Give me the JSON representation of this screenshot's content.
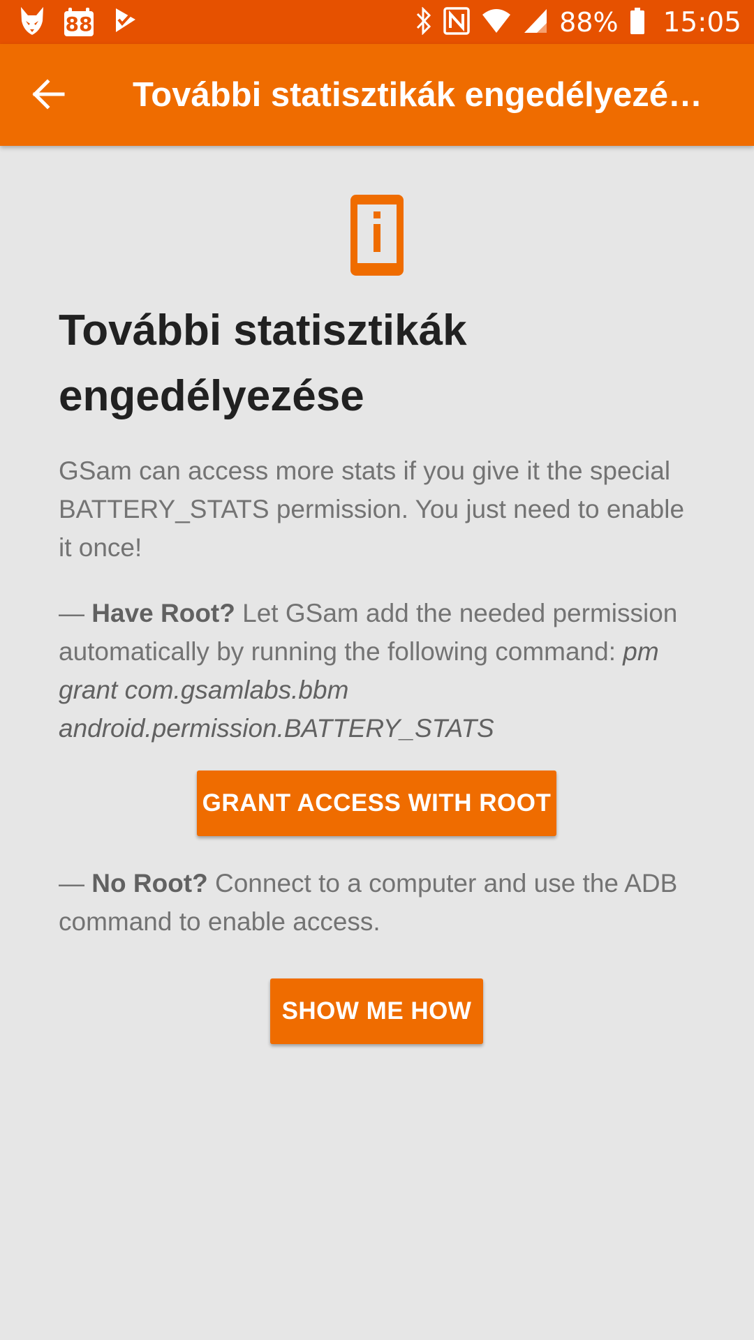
{
  "status_bar": {
    "notification_icons": [
      "fox-icon",
      "calendar-88-icon",
      "checkmark-flag-icon"
    ],
    "calendar_number": "88",
    "system_icons": [
      "bluetooth-icon",
      "nfc-icon",
      "wifi-icon",
      "signal-icon",
      "battery-icon"
    ],
    "battery_percent": "88%",
    "time": "15:05"
  },
  "app_bar": {
    "back_icon": "arrow-left-icon",
    "title": "További statisztikák engedélyezé…"
  },
  "content": {
    "hero_icon": "phone-info-icon",
    "heading": "További statisztikák engedélyezése",
    "intro": "GSam can access more stats if you give it the special BATTERY_STATS permission. You just need to enable it once!",
    "root_section": {
      "dash": "— ",
      "title": "Have Root?",
      "text": " Let GSam add the needed permission automatically by running the following command: ",
      "command": "pm grant com.gsamlabs.bbm android.permission.BATTERY_STATS"
    },
    "grant_button": "GRANT ACCESS WITH ROOT",
    "noroot_section": {
      "dash": "— ",
      "title": "No Root?",
      "text": " Connect to a computer and use the ADB command to enable access."
    },
    "show_button": "SHOW ME HOW"
  },
  "colors": {
    "status_bar": "#e65100",
    "app_bar": "#ef6c00",
    "accent": "#ef6c00",
    "background": "#e6e6e6",
    "heading": "#212121",
    "body_text": "#737373"
  }
}
